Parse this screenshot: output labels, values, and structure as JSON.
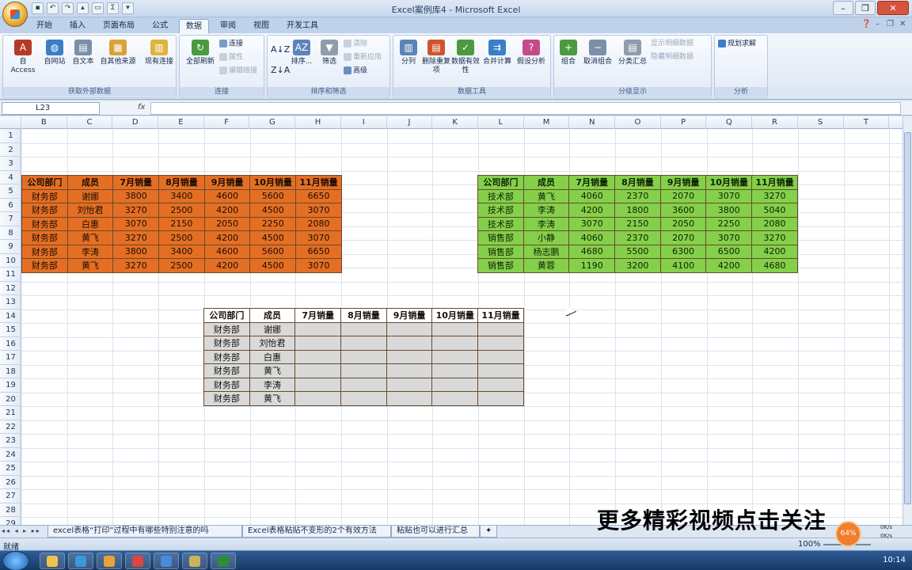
{
  "window": {
    "title": "Excel案例库4 - Microsoft Excel"
  },
  "tabs": [
    "开始",
    "插入",
    "页面布局",
    "公式",
    "数据",
    "审阅",
    "视图",
    "开发工具"
  ],
  "active_tab": "数据",
  "ribbon": {
    "groups": {
      "external_data": {
        "label": "获取外部数据",
        "buttons": [
          "自 Access",
          "自网站",
          "自文本",
          "自其他来源",
          "现有连接"
        ]
      },
      "connections": {
        "label": "连接",
        "refresh": "全部刷新",
        "small": [
          "连接",
          "属性",
          "编辑链接"
        ]
      },
      "sort_filter": {
        "label": "排序和筛选",
        "sort": "排序...",
        "filter": "筛选",
        "small": [
          "清除",
          "重新应用",
          "高级"
        ]
      },
      "data_tools": {
        "label": "数据工具",
        "buttons": [
          "分列",
          "删除重复项",
          "数据有效性",
          "合并计算",
          "假设分析"
        ]
      },
      "outline": {
        "label": "分级显示",
        "buttons": [
          "组合",
          "取消组合",
          "分类汇总"
        ],
        "small": [
          "显示明细数据",
          "隐藏明细数据"
        ]
      },
      "analysis": {
        "label": "分析",
        "solver": "规划求解"
      }
    }
  },
  "formula_bar": {
    "name_box": "L23",
    "fx": "fx",
    "value": ""
  },
  "columns": [
    "B",
    "C",
    "D",
    "E",
    "F",
    "G",
    "H",
    "I",
    "J",
    "K",
    "L",
    "M",
    "N",
    "O",
    "P",
    "Q",
    "R",
    "S",
    "T"
  ],
  "rows": [
    "1",
    "2",
    "3",
    "4",
    "5",
    "6",
    "7",
    "8",
    "9",
    "10",
    "11",
    "12",
    "13",
    "14",
    "15",
    "16",
    "17",
    "18",
    "19",
    "20",
    "21",
    "22",
    "23",
    "24",
    "25",
    "26",
    "27",
    "28",
    "29",
    "30",
    "31",
    "32"
  ],
  "table_orange": {
    "headers": [
      "公司部门",
      "成员",
      "7月销量",
      "8月销量",
      "9月销量",
      "10月销量",
      "11月销量"
    ],
    "rows": [
      [
        "财务部",
        "谢娜",
        "3800",
        "3400",
        "4600",
        "5600",
        "6650"
      ],
      [
        "财务部",
        "刘怡君",
        "3270",
        "2500",
        "4200",
        "4500",
        "3070"
      ],
      [
        "财务部",
        "白惠",
        "3070",
        "2150",
        "2050",
        "2250",
        "2080"
      ],
      [
        "财务部",
        "黄飞",
        "3270",
        "2500",
        "4200",
        "4500",
        "3070"
      ],
      [
        "财务部",
        "李涛",
        "3800",
        "3400",
        "4600",
        "5600",
        "6650"
      ],
      [
        "财务部",
        "黄飞",
        "3270",
        "2500",
        "4200",
        "4500",
        "3070"
      ]
    ]
  },
  "table_green": {
    "headers": [
      "公司部门",
      "成员",
      "7月销量",
      "8月销量",
      "9月销量",
      "10月销量",
      "11月销量"
    ],
    "rows": [
      [
        "技术部",
        "黄飞",
        "4060",
        "2370",
        "2070",
        "3070",
        "3270"
      ],
      [
        "技术部",
        "李涛",
        "4200",
        "1800",
        "3600",
        "3800",
        "5040"
      ],
      [
        "技术部",
        "李涛",
        "3070",
        "2150",
        "2050",
        "2250",
        "2080"
      ],
      [
        "销售部",
        "小静",
        "4060",
        "2370",
        "2070",
        "3070",
        "3270"
      ],
      [
        "销售部",
        "杨志鹏",
        "4680",
        "5500",
        "6300",
        "6500",
        "4200"
      ],
      [
        "销售部",
        "黄蓉",
        "1190",
        "3200",
        "4100",
        "4200",
        "4680"
      ]
    ]
  },
  "table_gray": {
    "headers": [
      "公司部门",
      "成员",
      "7月销量",
      "8月销量",
      "9月销量",
      "10月销量",
      "11月销量"
    ],
    "rows": [
      [
        "财务部",
        "谢娜",
        "",
        "",
        "",
        "",
        ""
      ],
      [
        "财务部",
        "刘怡君",
        "",
        "",
        "",
        "",
        ""
      ],
      [
        "财务部",
        "白惠",
        "",
        "",
        "",
        "",
        ""
      ],
      [
        "财务部",
        "黄飞",
        "",
        "",
        "",
        "",
        ""
      ],
      [
        "财务部",
        "李涛",
        "",
        "",
        "",
        "",
        ""
      ],
      [
        "财务部",
        "黄飞",
        "",
        "",
        "",
        "",
        ""
      ]
    ]
  },
  "sheet_tabs": [
    "excel表格“打印”过程中有哪些特别注意的吗",
    "Excel表格粘贴不变形的2个有效方法",
    "粘贴也可以进行汇总"
  ],
  "status": {
    "ready": "就绪",
    "zoom": "100%"
  },
  "overlay": {
    "watermark": "更多精彩视频点击关注",
    "net_percent": "64%",
    "net_up": "0K/s",
    "net_down": "0K/s"
  },
  "taskbar": {
    "clock": "10:14"
  },
  "colors": {
    "orange_table": "#e46f24",
    "green_table": "#84d04a",
    "gray_table": "#d9d9d9",
    "ribbon_bg": "#dbe6f4"
  }
}
